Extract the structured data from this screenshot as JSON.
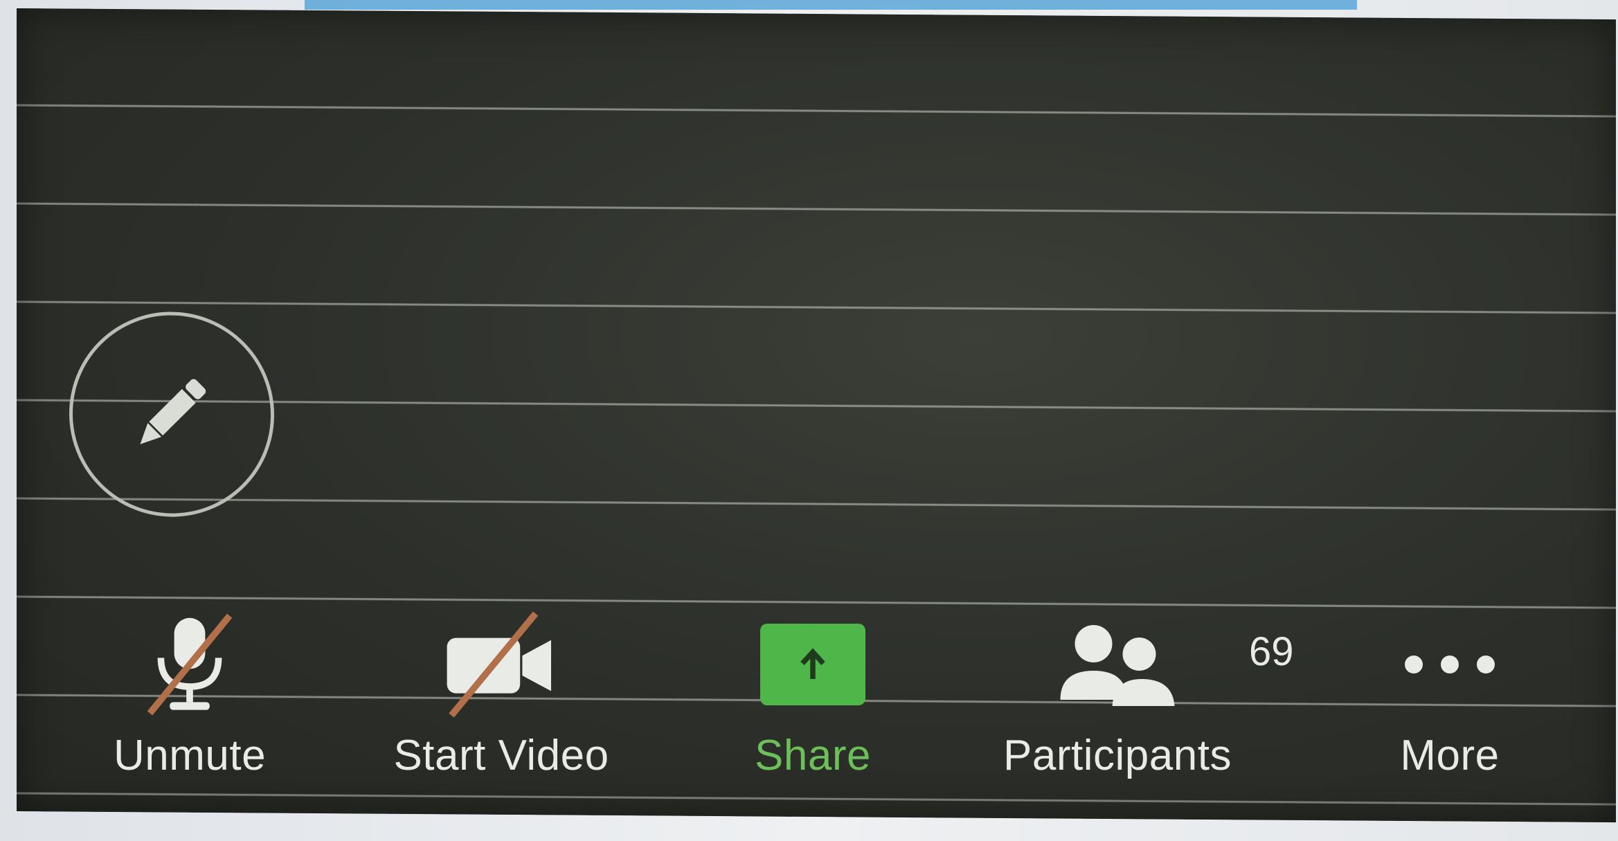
{
  "meeting": {
    "annotate_icon": "pencil-icon"
  },
  "toolbar": {
    "unmute": {
      "label": "Unmute",
      "icon": "microphone-muted-icon",
      "state": "muted"
    },
    "start_video": {
      "label": "Start Video",
      "icon": "video-camera-off-icon",
      "state": "off"
    },
    "share": {
      "label": "Share",
      "icon": "share-upload-icon",
      "color": "#4fb64a",
      "label_color": "#6dbf5a"
    },
    "participants": {
      "label": "Participants",
      "icon": "participants-icon",
      "count": "69"
    },
    "more": {
      "label": "More",
      "icon": "more-dots-icon"
    }
  },
  "colors": {
    "screen_bg": "#2c2f2a",
    "toolbar_text": "#e8ebe6",
    "mute_slash": "#b2704a"
  }
}
